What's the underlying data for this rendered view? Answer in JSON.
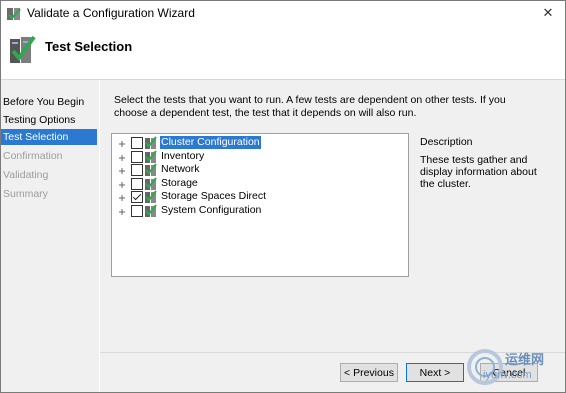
{
  "window": {
    "title": "Validate a Configuration Wizard",
    "close_glyph": "✕"
  },
  "header": {
    "title": "Test Selection"
  },
  "nav": {
    "items": [
      {
        "label": "Before You Begin",
        "state": "normal"
      },
      {
        "label": "Testing Options",
        "state": "normal"
      },
      {
        "label": "Test Selection",
        "state": "active"
      },
      {
        "label": "Confirmation",
        "state": "disabled"
      },
      {
        "label": "Validating",
        "state": "disabled"
      },
      {
        "label": "Summary",
        "state": "disabled"
      }
    ]
  },
  "main": {
    "instructions": "Select the tests that you want to run.  A few tests are dependent on other tests.  If you choose a dependent test, the test that it depends on will also run.",
    "tree": [
      {
        "label": "Cluster Configuration",
        "checked": false,
        "selected": true
      },
      {
        "label": "Inventory",
        "checked": false,
        "selected": false
      },
      {
        "label": "Network",
        "checked": false,
        "selected": false
      },
      {
        "label": "Storage",
        "checked": false,
        "selected": false
      },
      {
        "label": "Storage Spaces Direct",
        "checked": true,
        "selected": false
      },
      {
        "label": "System Configuration",
        "checked": false,
        "selected": false
      }
    ],
    "description_heading": "Description",
    "description_text": "These tests gather and display information about the cluster."
  },
  "buttons": {
    "previous": "< Previous",
    "next": "Next >",
    "cancel": "Cancel"
  },
  "watermark": {
    "text": "运维网",
    "sub": "iyunv.com"
  },
  "colors": {
    "accent": "#2b79d0",
    "panel": "#f0f0f0",
    "disabled_text": "#9d9d9d"
  }
}
